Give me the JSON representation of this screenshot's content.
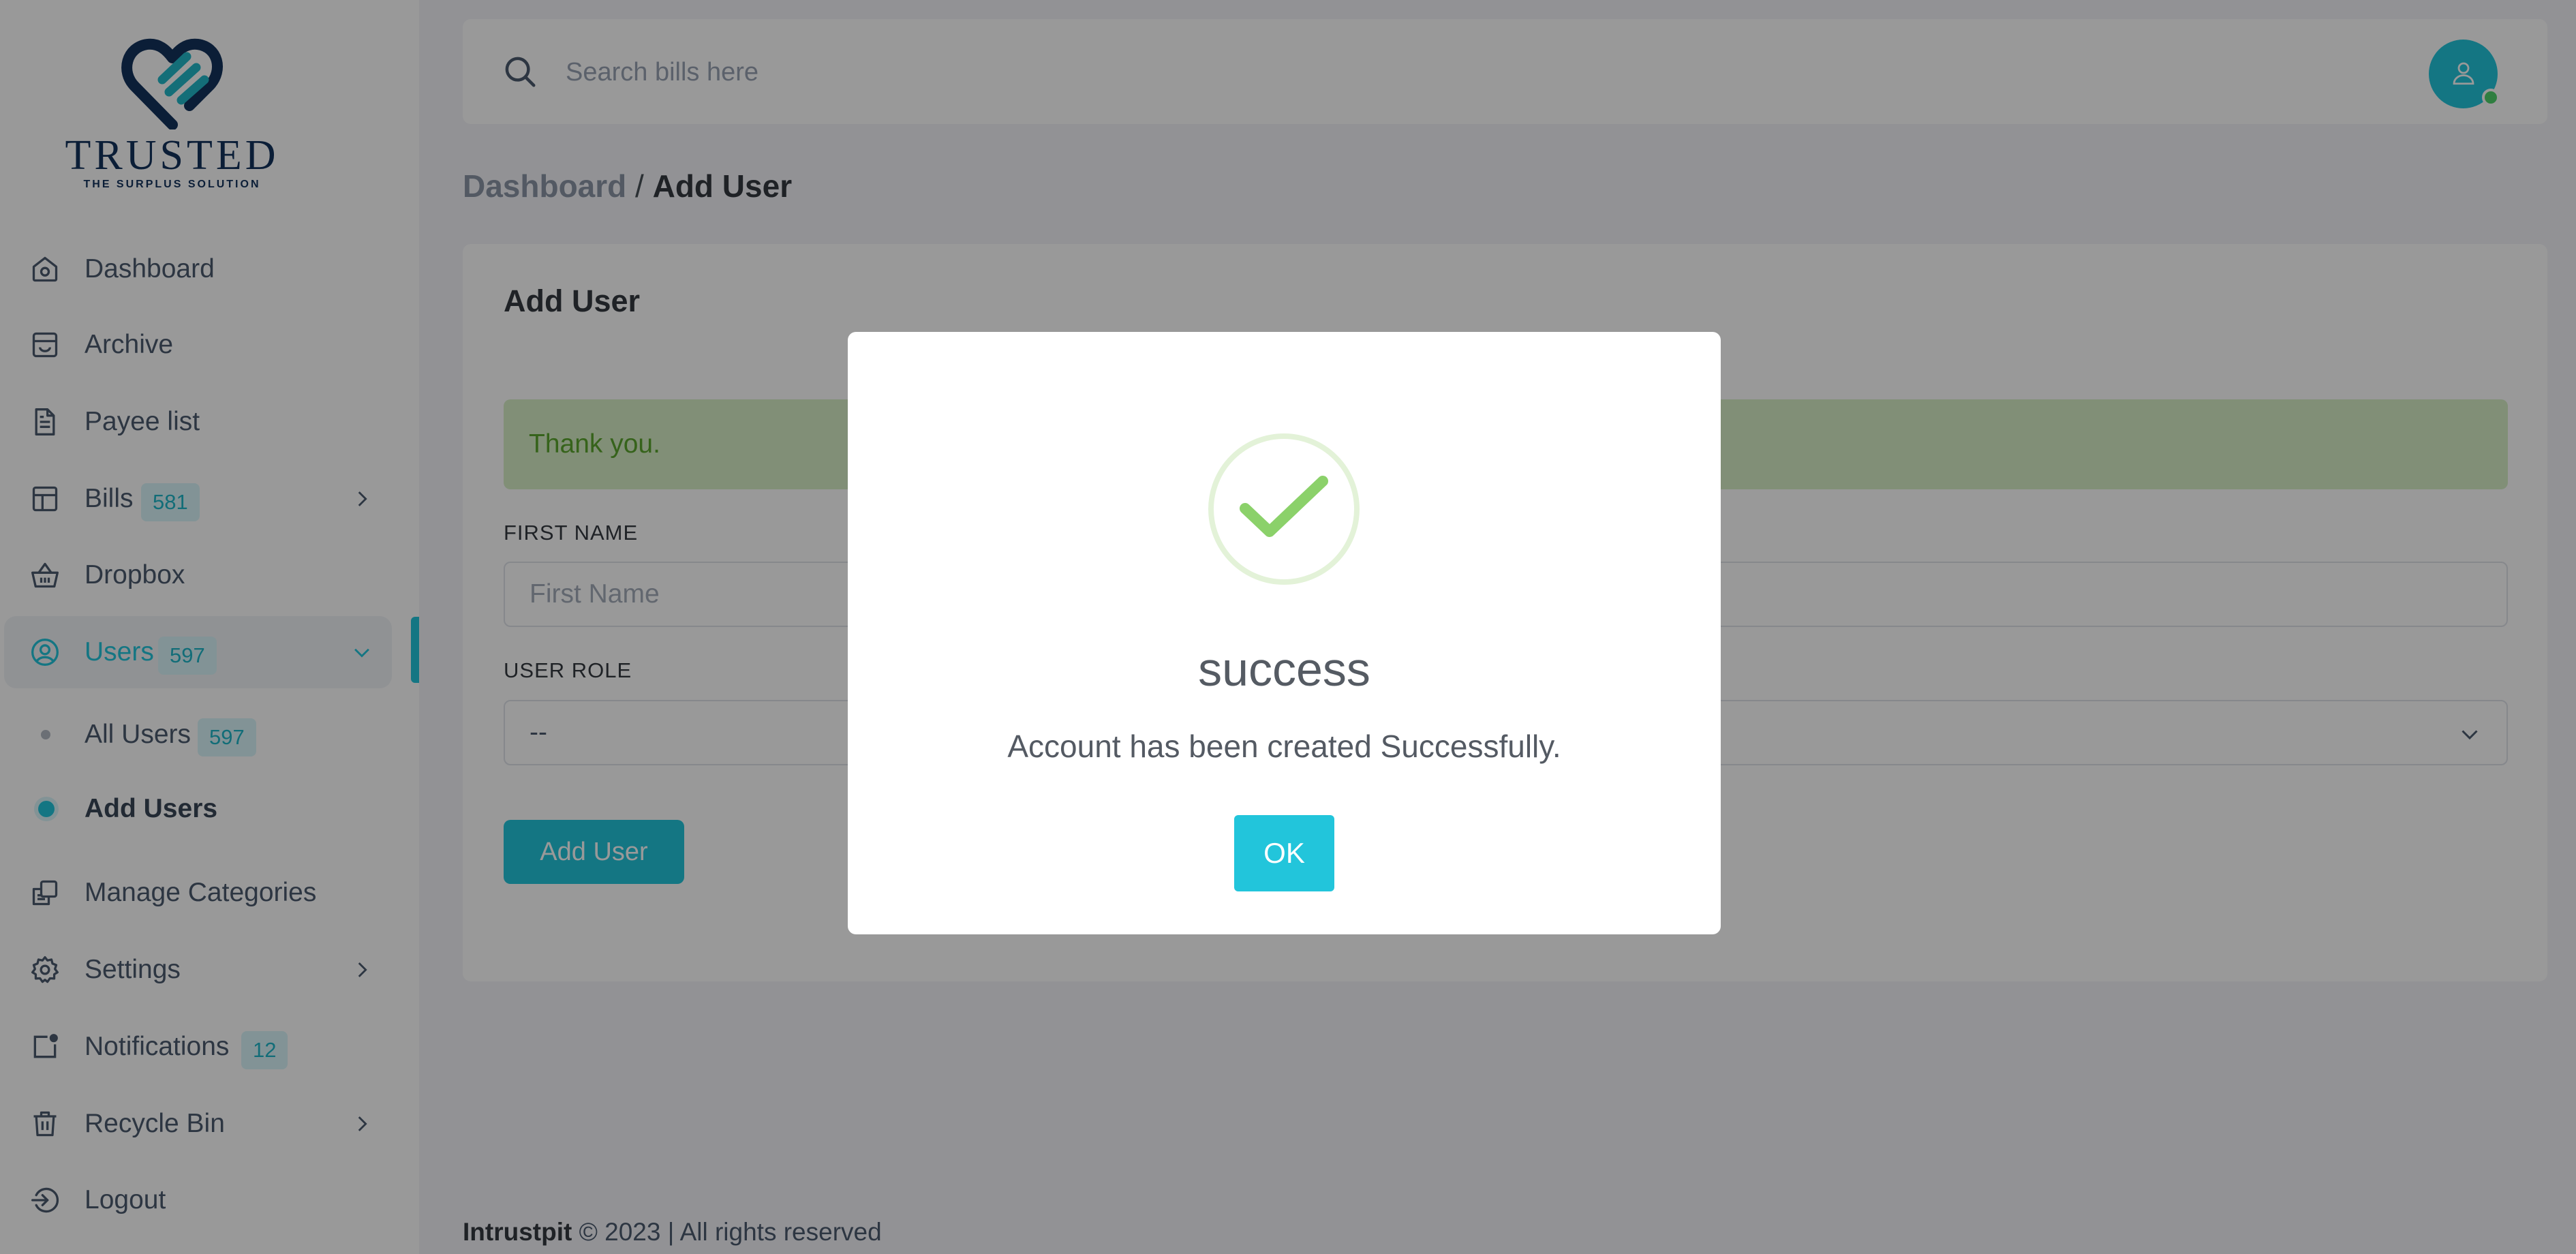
{
  "brand": {
    "name": "TRUSTED",
    "tagline": "THE SURPLUS SOLUTION"
  },
  "colors": {
    "accent": "#22c5db",
    "sidebar_bg": "#ffffff",
    "success": "#8bd16a",
    "alert_text": "#5aa52d"
  },
  "sidebar": {
    "items": [
      {
        "label": "Dashboard",
        "icon": "home-icon"
      },
      {
        "label": "Archive",
        "icon": "archive-icon"
      },
      {
        "label": "Payee list",
        "icon": "document-icon"
      },
      {
        "label": "Bills",
        "icon": "layout-icon",
        "badge": "581"
      },
      {
        "label": "Dropbox",
        "icon": "basket-icon"
      },
      {
        "label": "Users",
        "icon": "user-circle-icon",
        "badge": "597"
      },
      {
        "label": "Manage Categories",
        "icon": "copy-icon"
      },
      {
        "label": "Settings",
        "icon": "gear-icon"
      },
      {
        "label": "Notifications",
        "icon": "notification-icon",
        "badge": "12"
      },
      {
        "label": "Recycle Bin",
        "icon": "trash-icon"
      },
      {
        "label": "Logout",
        "icon": "logout-icon"
      }
    ],
    "users_sub": [
      {
        "label": "All Users",
        "badge": "597"
      },
      {
        "label": "Add Users"
      }
    ]
  },
  "header": {
    "search_placeholder": "Search bills here"
  },
  "breadcrumb": {
    "parent": "Dashboard",
    "separator": " / ",
    "current": "Add User"
  },
  "form": {
    "title": "Add User",
    "alert": "Thank you.",
    "first_name_label": "FIRST NAME",
    "first_name_placeholder": "First Name",
    "user_role_label": "USER ROLE",
    "user_role_value": "--",
    "submit_label": "Add User"
  },
  "modal": {
    "title": "success",
    "message": "Account has been created Successfully.",
    "ok_label": "OK"
  },
  "footer": {
    "brand": "Intrustpit",
    "text": " © 2023 | All rights reserved"
  }
}
